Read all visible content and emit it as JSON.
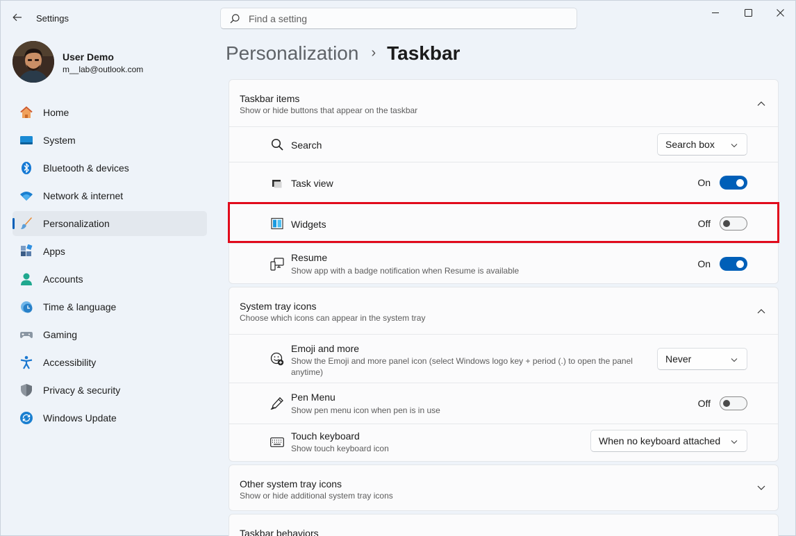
{
  "app": {
    "title": "Settings"
  },
  "search": {
    "placeholder": "Find a setting"
  },
  "user": {
    "name": "User Demo",
    "email": "m__lab@outlook.com"
  },
  "nav": [
    {
      "label": "Home",
      "icon": "home-icon"
    },
    {
      "label": "System",
      "icon": "system-icon"
    },
    {
      "label": "Bluetooth & devices",
      "icon": "bluetooth-icon"
    },
    {
      "label": "Network & internet",
      "icon": "wifi-icon"
    },
    {
      "label": "Personalization",
      "icon": "brush-icon",
      "active": true
    },
    {
      "label": "Apps",
      "icon": "apps-icon"
    },
    {
      "label": "Accounts",
      "icon": "accounts-icon"
    },
    {
      "label": "Time & language",
      "icon": "clock-icon"
    },
    {
      "label": "Gaming",
      "icon": "gamepad-icon"
    },
    {
      "label": "Accessibility",
      "icon": "accessibility-icon"
    },
    {
      "label": "Privacy & security",
      "icon": "shield-icon"
    },
    {
      "label": "Windows Update",
      "icon": "update-icon"
    }
  ],
  "breadcrumb": {
    "parent": "Personalization",
    "separator": "›",
    "current": "Taskbar"
  },
  "taskbar_items": {
    "title": "Taskbar items",
    "subtitle": "Show or hide buttons that appear on the taskbar",
    "search": {
      "title": "Search",
      "value": "Search box"
    },
    "task_view": {
      "title": "Task view",
      "state": "On"
    },
    "widgets": {
      "title": "Widgets",
      "state": "Off"
    },
    "resume": {
      "title": "Resume",
      "subtitle": "Show app with a badge notification when Resume is available",
      "state": "On"
    }
  },
  "system_tray": {
    "title": "System tray icons",
    "subtitle": "Choose which icons can appear in the system tray",
    "emoji": {
      "title": "Emoji and more",
      "subtitle": "Show the Emoji and more panel icon (select Windows logo key + period (.) to open the panel anytime)",
      "value": "Never"
    },
    "pen": {
      "title": "Pen Menu",
      "subtitle": "Show pen menu icon when pen is in use",
      "state": "Off"
    },
    "touch_keyboard": {
      "title": "Touch keyboard",
      "subtitle": "Show touch keyboard icon",
      "value": "When no keyboard attached"
    }
  },
  "other_tray": {
    "title": "Other system tray icons",
    "subtitle": "Show or hide additional system tray icons"
  },
  "behaviors": {
    "title": "Taskbar behaviors"
  },
  "colors": {
    "accent": "#005fb8",
    "highlight": "#e10b1c"
  }
}
